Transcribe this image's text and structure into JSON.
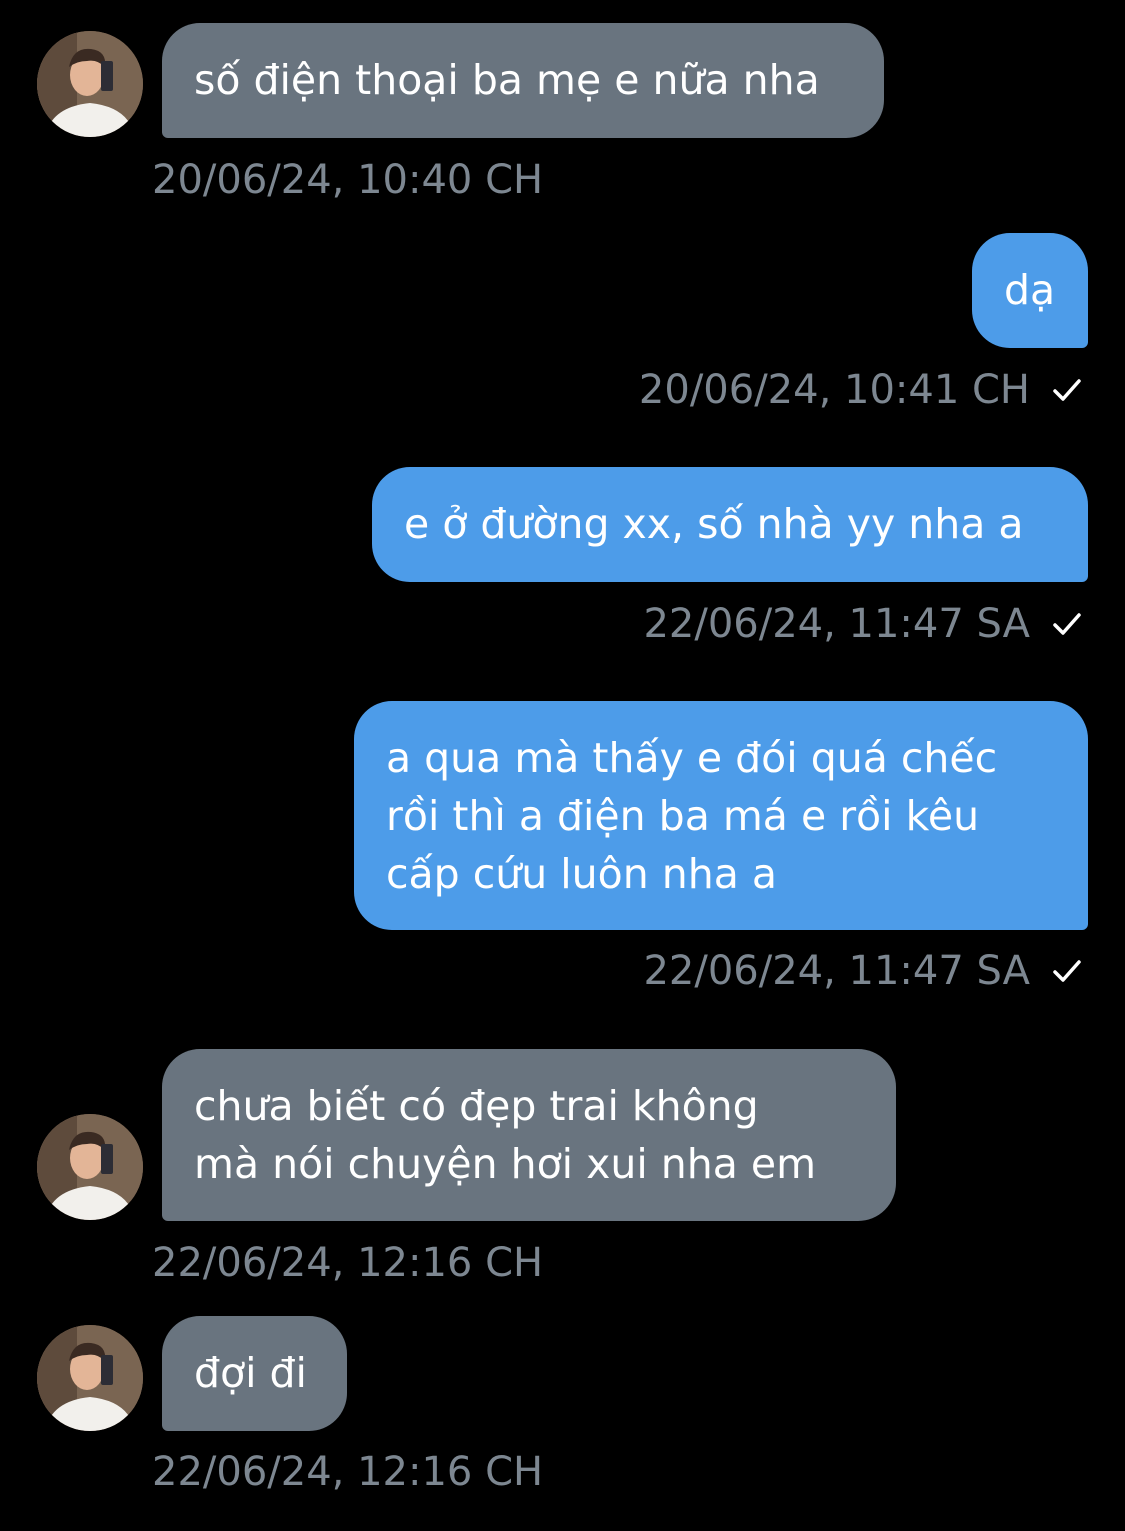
{
  "colors": {
    "background": "#000000",
    "incoming_bubble": "#69747f",
    "outgoing_bubble": "#4d9ce9",
    "timestamp": "#7d8791",
    "check": "#ffffff"
  },
  "messages": [
    {
      "direction": "incoming",
      "lines": [
        "số điện thoại ba mẹ e nữa nha"
      ],
      "timestamp": "20/06/24, 10:40 CH",
      "avatar_icon": "user-avatar-icon"
    },
    {
      "direction": "outgoing",
      "lines": [
        "dạ"
      ],
      "timestamp": "20/06/24, 10:41 CH",
      "status_icon": "check-icon"
    },
    {
      "direction": "outgoing",
      "lines": [
        "e ở đường xx, số nhà yy nha a"
      ],
      "timestamp": "22/06/24, 11:47 SA",
      "status_icon": "check-icon"
    },
    {
      "direction": "outgoing",
      "lines": [
        "a qua mà thấy e đói quá chếc",
        "rồi thì a điện ba má e rồi kêu",
        "cấp cứu luôn nha a"
      ],
      "timestamp": "22/06/24, 11:47 SA",
      "status_icon": "check-icon"
    },
    {
      "direction": "incoming",
      "lines": [
        "chưa biết có đẹp trai không",
        "mà nói chuyện hơi xui nha em"
      ],
      "timestamp": "22/06/24, 12:16 CH",
      "avatar_icon": "user-avatar-icon"
    },
    {
      "direction": "incoming",
      "lines": [
        "đợi đi"
      ],
      "timestamp": "22/06/24, 12:16 CH",
      "avatar_icon": "user-avatar-icon"
    }
  ]
}
